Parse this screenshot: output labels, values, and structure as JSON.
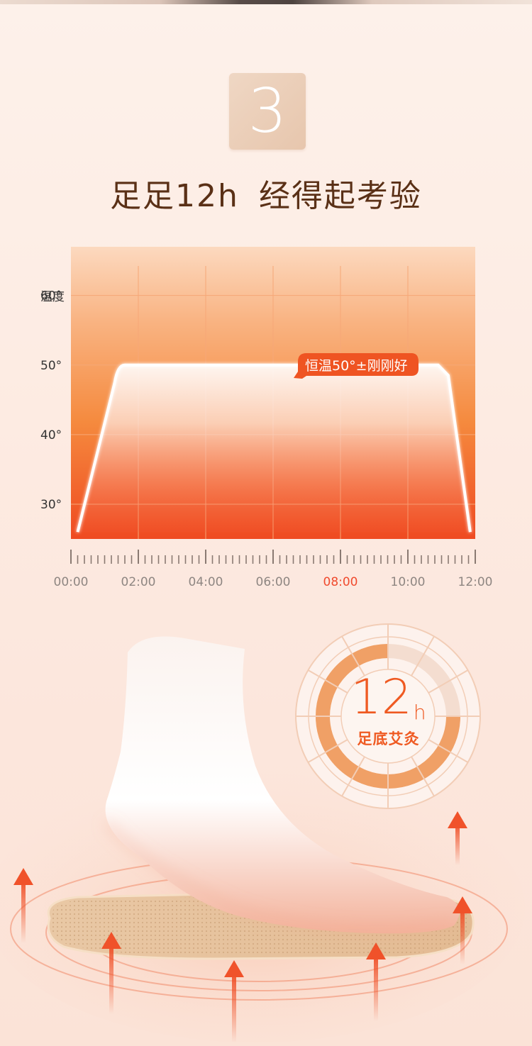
{
  "badge": {
    "number": "3"
  },
  "headline": {
    "part1": "足足12h",
    "part2": "经得起考验"
  },
  "chart_data": {
    "type": "area",
    "ylabel": "温度",
    "y_ticks": [
      "60°",
      "50°",
      "40°",
      "30°"
    ],
    "y_tick_values": [
      60,
      50,
      40,
      30
    ],
    "x_ticks": [
      "00:00",
      "02:00",
      "04:00",
      "06:00",
      "08:00",
      "10:00",
      "12:00"
    ],
    "highlighted_tick": "08:00",
    "x_hours": [
      0,
      2,
      4,
      6,
      8,
      10,
      12
    ],
    "ylim": [
      25,
      67
    ],
    "series": [
      {
        "x": [
          0.2,
          1.3,
          1.6,
          10.9,
          11.2,
          11.85
        ],
        "y": [
          26,
          47.5,
          50,
          50,
          48.5,
          26
        ]
      }
    ],
    "annotation": "恒温50°±刚刚好",
    "colors": {
      "accent": "#ef5a22",
      "grid": "#f6a777",
      "highlight_tick": "#f04a2e"
    }
  },
  "ring": {
    "value": "12",
    "unit": "h",
    "caption": "足底艾灸",
    "progress": 0.75
  }
}
